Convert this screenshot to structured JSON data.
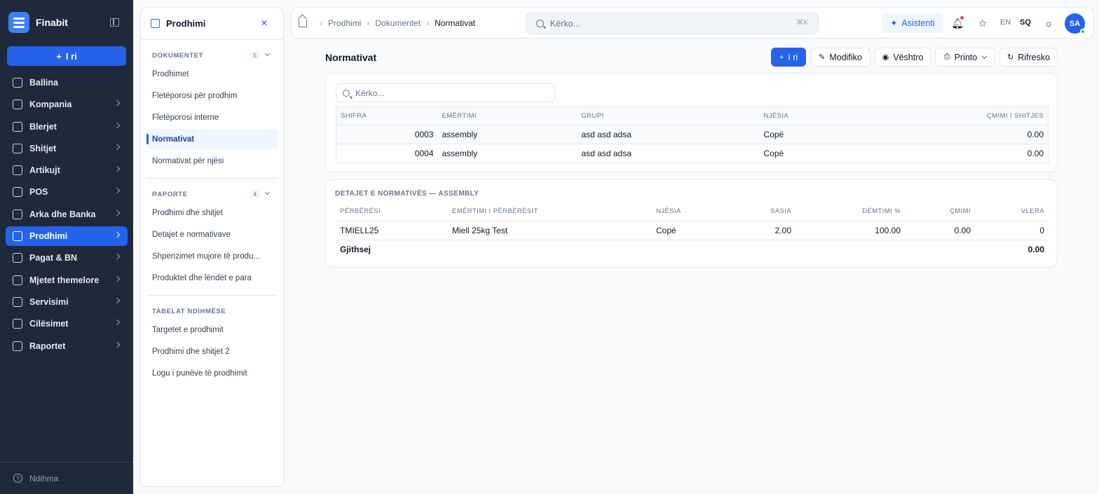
{
  "brand": {
    "name": "Finabit"
  },
  "sidebar": {
    "new_label": "I ri",
    "items": [
      {
        "label": "Ballina",
        "icon": "home-icon",
        "chevron": false
      },
      {
        "label": "Kompania",
        "icon": "building-icon",
        "chevron": true
      },
      {
        "label": "Blerjet",
        "icon": "truck-icon",
        "chevron": true
      },
      {
        "label": "Shitjet",
        "icon": "shopping-bag-icon",
        "chevron": true
      },
      {
        "label": "Artikujt",
        "icon": "box-icon",
        "chevron": true
      },
      {
        "label": "POS",
        "icon": "store-icon",
        "chevron": true
      },
      {
        "label": "Arka dhe Banka",
        "icon": "bank-icon",
        "chevron": true
      },
      {
        "label": "Prodhimi",
        "icon": "factory-icon",
        "chevron": true,
        "active": true
      },
      {
        "label": "Pagat & BN",
        "icon": "coins-icon",
        "chevron": true
      },
      {
        "label": "Mjetet themelore",
        "icon": "assets-icon",
        "chevron": true
      },
      {
        "label": "Servisimi",
        "icon": "wrench-icon",
        "chevron": true
      },
      {
        "label": "Cilësimet",
        "icon": "gear-icon",
        "chevron": true
      },
      {
        "label": "Raportet",
        "icon": "bar-chart-icon",
        "chevron": true
      }
    ],
    "help_label": "Ndihma"
  },
  "subpanel": {
    "title": "Prodhimi",
    "sections": [
      {
        "title": "DOKUMENTET",
        "count": "5",
        "items": [
          "Prodhimet",
          "Fletëporosi për prodhim",
          "Fletëporosi interne",
          "Normativat",
          "Normativat për njësi"
        ],
        "active": 3
      },
      {
        "title": "RAPORTE",
        "count": "4",
        "items": [
          "Prodhimi dhe shitjet",
          "Detajet e normativave",
          "Shpenzimet mujore të produ...",
          "Produktet dhe lëndët e para"
        ]
      },
      {
        "title": "TABELAT NDIHMËSE",
        "items": [
          "Targetet e prodhimit",
          "Prodhimi dhe shitjet 2",
          "Logu i punëve të prodhimit"
        ]
      }
    ]
  },
  "topbar": {
    "breadcrumb": [
      "Prodhimi",
      "Dokumentet",
      "Normativat"
    ],
    "search_placeholder": "Kërko...",
    "shortcut": "⌘K",
    "assistant_label": "Asistenti",
    "lang_en": "EN",
    "lang_sq": "SQ",
    "avatar": "SA"
  },
  "page": {
    "title": "Normativat",
    "actions": {
      "new": "I ri",
      "edit": "Modifiko",
      "view": "Vështro",
      "print": "Printo",
      "refresh": "Rifresko"
    }
  },
  "main_table": {
    "search_placeholder": "Kërko...",
    "columns": [
      "SHIFRA",
      "EMËRTIMI",
      "GRUPI",
      "NJËSIA",
      "ÇMIMI I SHITJES"
    ],
    "rows": [
      [
        "0003",
        "assembly",
        "asd asd adsa",
        "Copë",
        "0.00"
      ],
      [
        "0004",
        "assembly",
        "asd asd adsa",
        "Copë",
        "0.00"
      ]
    ]
  },
  "details": {
    "title": "DETAJET E NORMATIVËS — ASSEMBLY",
    "columns": [
      "PËRBËRËSI",
      "EMËRTIMI I PËRBËRËSIT",
      "NJËSIA",
      "SASIA",
      "DËMTIMI %",
      "ÇMIMI",
      "VLERA"
    ],
    "rows": [
      [
        "TMIELL25",
        "Miell 25kg Test",
        "Copë",
        "2.00",
        "100.00",
        "0.00",
        "0"
      ]
    ],
    "total_label": "Gjithsej",
    "total_value": "0.00"
  }
}
